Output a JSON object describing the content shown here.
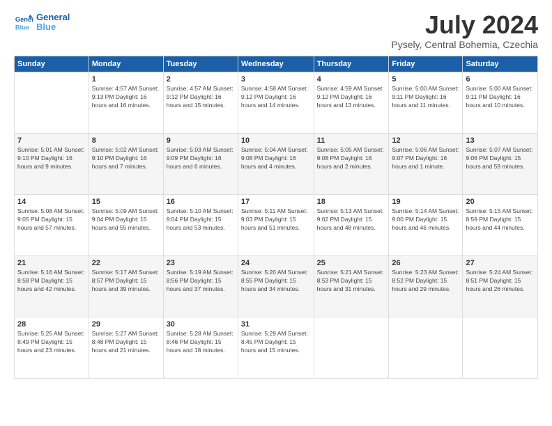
{
  "header": {
    "logo_line1": "General",
    "logo_line2": "Blue",
    "month": "July 2024",
    "location": "Pysely, Central Bohemia, Czechia"
  },
  "weekdays": [
    "Sunday",
    "Monday",
    "Tuesday",
    "Wednesday",
    "Thursday",
    "Friday",
    "Saturday"
  ],
  "weeks": [
    [
      {
        "day": "",
        "info": ""
      },
      {
        "day": "1",
        "info": "Sunrise: 4:57 AM\nSunset: 9:13 PM\nDaylight: 16 hours\nand 16 minutes."
      },
      {
        "day": "2",
        "info": "Sunrise: 4:57 AM\nSunset: 9:12 PM\nDaylight: 16 hours\nand 15 minutes."
      },
      {
        "day": "3",
        "info": "Sunrise: 4:58 AM\nSunset: 9:12 PM\nDaylight: 16 hours\nand 14 minutes."
      },
      {
        "day": "4",
        "info": "Sunrise: 4:59 AM\nSunset: 9:12 PM\nDaylight: 16 hours\nand 13 minutes."
      },
      {
        "day": "5",
        "info": "Sunrise: 5:00 AM\nSunset: 9:11 PM\nDaylight: 16 hours\nand 11 minutes."
      },
      {
        "day": "6",
        "info": "Sunrise: 5:00 AM\nSunset: 9:11 PM\nDaylight: 16 hours\nand 10 minutes."
      }
    ],
    [
      {
        "day": "7",
        "info": "Sunrise: 5:01 AM\nSunset: 9:10 PM\nDaylight: 16 hours\nand 9 minutes."
      },
      {
        "day": "8",
        "info": "Sunrise: 5:02 AM\nSunset: 9:10 PM\nDaylight: 16 hours\nand 7 minutes."
      },
      {
        "day": "9",
        "info": "Sunrise: 5:03 AM\nSunset: 9:09 PM\nDaylight: 16 hours\nand 6 minutes."
      },
      {
        "day": "10",
        "info": "Sunrise: 5:04 AM\nSunset: 9:08 PM\nDaylight: 16 hours\nand 4 minutes."
      },
      {
        "day": "11",
        "info": "Sunrise: 5:05 AM\nSunset: 9:08 PM\nDaylight: 16 hours\nand 2 minutes."
      },
      {
        "day": "12",
        "info": "Sunrise: 5:06 AM\nSunset: 9:07 PM\nDaylight: 16 hours\nand 1 minute."
      },
      {
        "day": "13",
        "info": "Sunrise: 5:07 AM\nSunset: 9:06 PM\nDaylight: 15 hours\nand 59 minutes."
      }
    ],
    [
      {
        "day": "14",
        "info": "Sunrise: 5:08 AM\nSunset: 9:05 PM\nDaylight: 15 hours\nand 57 minutes."
      },
      {
        "day": "15",
        "info": "Sunrise: 5:09 AM\nSunset: 9:04 PM\nDaylight: 15 hours\nand 55 minutes."
      },
      {
        "day": "16",
        "info": "Sunrise: 5:10 AM\nSunset: 9:04 PM\nDaylight: 15 hours\nand 53 minutes."
      },
      {
        "day": "17",
        "info": "Sunrise: 5:11 AM\nSunset: 9:03 PM\nDaylight: 15 hours\nand 51 minutes."
      },
      {
        "day": "18",
        "info": "Sunrise: 5:13 AM\nSunset: 9:02 PM\nDaylight: 15 hours\nand 48 minutes."
      },
      {
        "day": "19",
        "info": "Sunrise: 5:14 AM\nSunset: 9:00 PM\nDaylight: 15 hours\nand 46 minutes."
      },
      {
        "day": "20",
        "info": "Sunrise: 5:15 AM\nSunset: 8:59 PM\nDaylight: 15 hours\nand 44 minutes."
      }
    ],
    [
      {
        "day": "21",
        "info": "Sunrise: 5:16 AM\nSunset: 8:58 PM\nDaylight: 15 hours\nand 42 minutes."
      },
      {
        "day": "22",
        "info": "Sunrise: 5:17 AM\nSunset: 8:57 PM\nDaylight: 15 hours\nand 39 minutes."
      },
      {
        "day": "23",
        "info": "Sunrise: 5:19 AM\nSunset: 8:56 PM\nDaylight: 15 hours\nand 37 minutes."
      },
      {
        "day": "24",
        "info": "Sunrise: 5:20 AM\nSunset: 8:55 PM\nDaylight: 15 hours\nand 34 minutes."
      },
      {
        "day": "25",
        "info": "Sunrise: 5:21 AM\nSunset: 8:53 PM\nDaylight: 15 hours\nand 31 minutes."
      },
      {
        "day": "26",
        "info": "Sunrise: 5:23 AM\nSunset: 8:52 PM\nDaylight: 15 hours\nand 29 minutes."
      },
      {
        "day": "27",
        "info": "Sunrise: 5:24 AM\nSunset: 8:51 PM\nDaylight: 15 hours\nand 26 minutes."
      }
    ],
    [
      {
        "day": "28",
        "info": "Sunrise: 5:25 AM\nSunset: 8:49 PM\nDaylight: 15 hours\nand 23 minutes."
      },
      {
        "day": "29",
        "info": "Sunrise: 5:27 AM\nSunset: 8:48 PM\nDaylight: 15 hours\nand 21 minutes."
      },
      {
        "day": "30",
        "info": "Sunrise: 5:28 AM\nSunset: 8:46 PM\nDaylight: 15 hours\nand 18 minutes."
      },
      {
        "day": "31",
        "info": "Sunrise: 5:29 AM\nSunset: 8:45 PM\nDaylight: 15 hours\nand 15 minutes."
      },
      {
        "day": "",
        "info": ""
      },
      {
        "day": "",
        "info": ""
      },
      {
        "day": "",
        "info": ""
      }
    ]
  ]
}
